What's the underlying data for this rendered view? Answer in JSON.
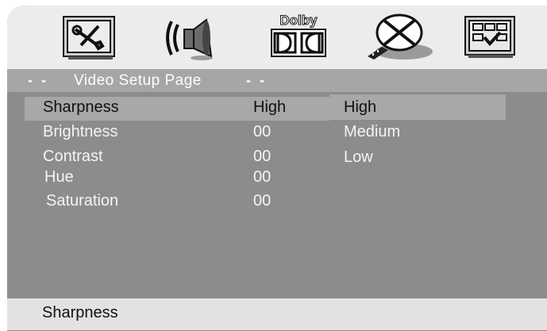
{
  "top_icons": [
    {
      "icon": "general-setup-icon"
    },
    {
      "icon": "audio-speaker-icon"
    },
    {
      "icon": "dolby-digital-icon",
      "label": "Dolby"
    },
    {
      "icon": "video-setup-icon"
    },
    {
      "icon": "preferences-icon"
    }
  ],
  "page_bar": {
    "left_dashes": "- -",
    "title": "Video Setup Page",
    "right_dashes": "- -"
  },
  "settings": [
    {
      "label": "Sharpness",
      "value": "High",
      "selected": true
    },
    {
      "label": "Brightness",
      "value": "00",
      "selected": false
    },
    {
      "label": "Contrast",
      "value": "00",
      "selected": false
    },
    {
      "label": "Hue",
      "value": "00",
      "selected": false
    },
    {
      "label": "Saturation",
      "value": "00",
      "selected": false
    }
  ],
  "options": [
    {
      "label": "High",
      "selected": true
    },
    {
      "label": "Medium",
      "selected": false
    },
    {
      "label": "Low",
      "selected": false
    }
  ],
  "footer": {
    "text": "Sharpness"
  },
  "colors": {
    "screen_bg": "#8c8c8c",
    "icon_bar_bg": "#ececec",
    "highlight": "#a8a8a8",
    "footer_bg": "#e2e2e2",
    "text_light": "#f4f4f4",
    "text_dark": "#111111"
  }
}
